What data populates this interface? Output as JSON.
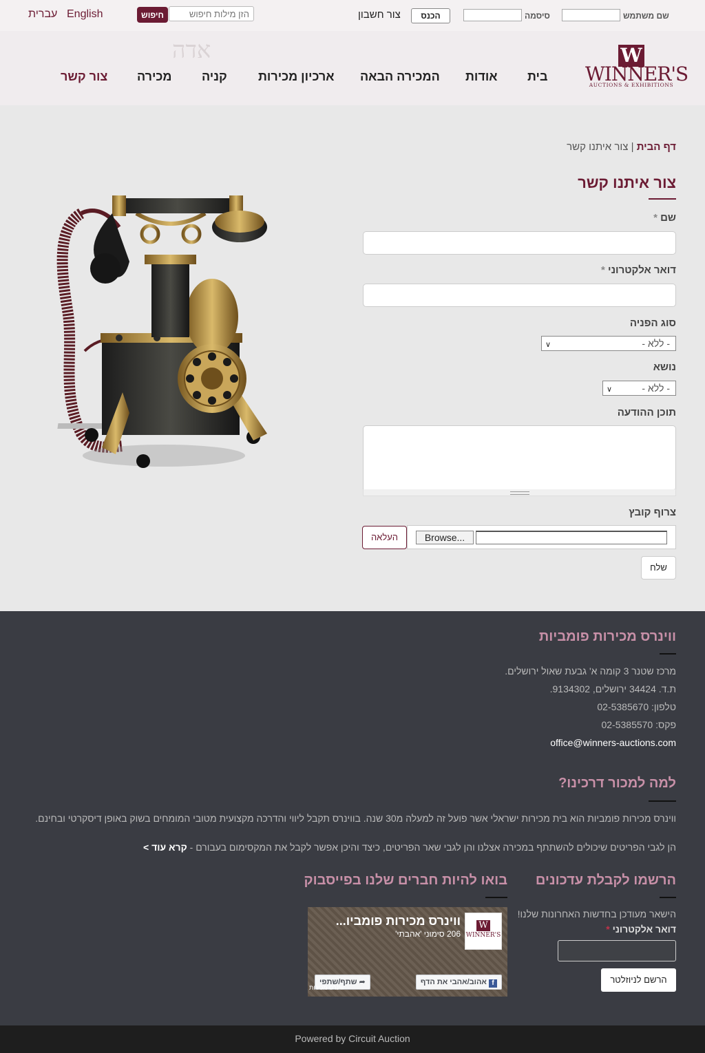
{
  "topbar": {
    "username_label": "שם משתמש",
    "password_label": "סיסמה",
    "login_button": "הכנס",
    "create_account": "צור חשבון",
    "search_placeholder": "הזן מילות חיפוש",
    "search_button": "חיפוש",
    "lang_en": "English",
    "lang_he": "עברית"
  },
  "header": {
    "logo_mark": "W",
    "logo_text": "WINNER'S",
    "logo_sub": "AUCTIONS & EXHIBITIONS",
    "nav": [
      {
        "label": "בית"
      },
      {
        "label": "אודות"
      },
      {
        "label": "המכירה הבאה"
      },
      {
        "label": "ארכיון מכירות"
      },
      {
        "label": "קניה"
      },
      {
        "label": "מכירה"
      },
      {
        "label": "צור קשר"
      }
    ]
  },
  "breadcrumb": {
    "home": "דף הבית",
    "separator": " | ",
    "current": "צור איתנו קשר"
  },
  "page_title": "צור איתנו קשר",
  "form": {
    "name_label": "שם",
    "email_label": "דואר אלקטרוני",
    "required_mark": "*",
    "type_label": "סוג הפניה",
    "type_value": "- ללא -",
    "subject_label": "נושא",
    "subject_value": "- ללא -",
    "message_label": "תוכן ההודעה",
    "attach_label": "צרוף קובץ",
    "browse_button": "Browse...",
    "upload_button": "העלאה",
    "send_button": "שלח"
  },
  "footer": {
    "company_heading": "ווינרס מכירות פומביות",
    "address": "מרכז שטנר 3 קומה א' גבעת שאול ירושלים.",
    "pobox": "ת.ד. 34424 ירושלים, 9134302.",
    "phone": "טלפון: 02-5385670",
    "fax": "פקס: 02-5385570",
    "email": "office@winners-auctions.com",
    "why_heading": "למה למכור דרכינו?",
    "why_text_1": "ווינרס מכירות פומביות הוא בית מכירות ישראלי אשר פועל זה למעלה מ30 שנה. בווינרס תקבל ליווי והדרכה מקצועית מטובי המומחים בשוק באופן דיסקרטי ובחינם.",
    "why_text_2": "הן לגבי הפריטים שיכולים להשתתף במכירה אצלנו והן לגבי שאר הפריטים, כיצד והיכן אפשר לקבל את המקסימום בעבורם -",
    "read_more": "קרא עוד >",
    "newsletter_heading": "הרשמו לקבלת עדכונים",
    "newsletter_text": "הישאר מעודכן בחדשות האחרונות שלנו!",
    "newsletter_email_label": "דואר אלקטרוני",
    "newsletter_button": "הרשם לניוזלטר",
    "facebook_heading": "בואו להיות חברים שלנו בפייסבוק",
    "fb_page_name": "ווינרס מכירות פומביו...",
    "fb_likes": "206 סימוני 'אהבתי'",
    "fb_like_button": "אהוב/אהבי את הדף",
    "fb_share_button": "שתף/שתפי",
    "fb_thumb_text": "WINNER'S",
    "fb_corner_text": "ווינרס מכירות"
  },
  "bottom": {
    "powered_by": "Powered by Circuit Auction"
  },
  "colors": {
    "brand": "#6b1b33",
    "footer_bg": "#3a3c43",
    "footer_heading": "#c890a8",
    "page_bg": "#e8e8e8"
  }
}
